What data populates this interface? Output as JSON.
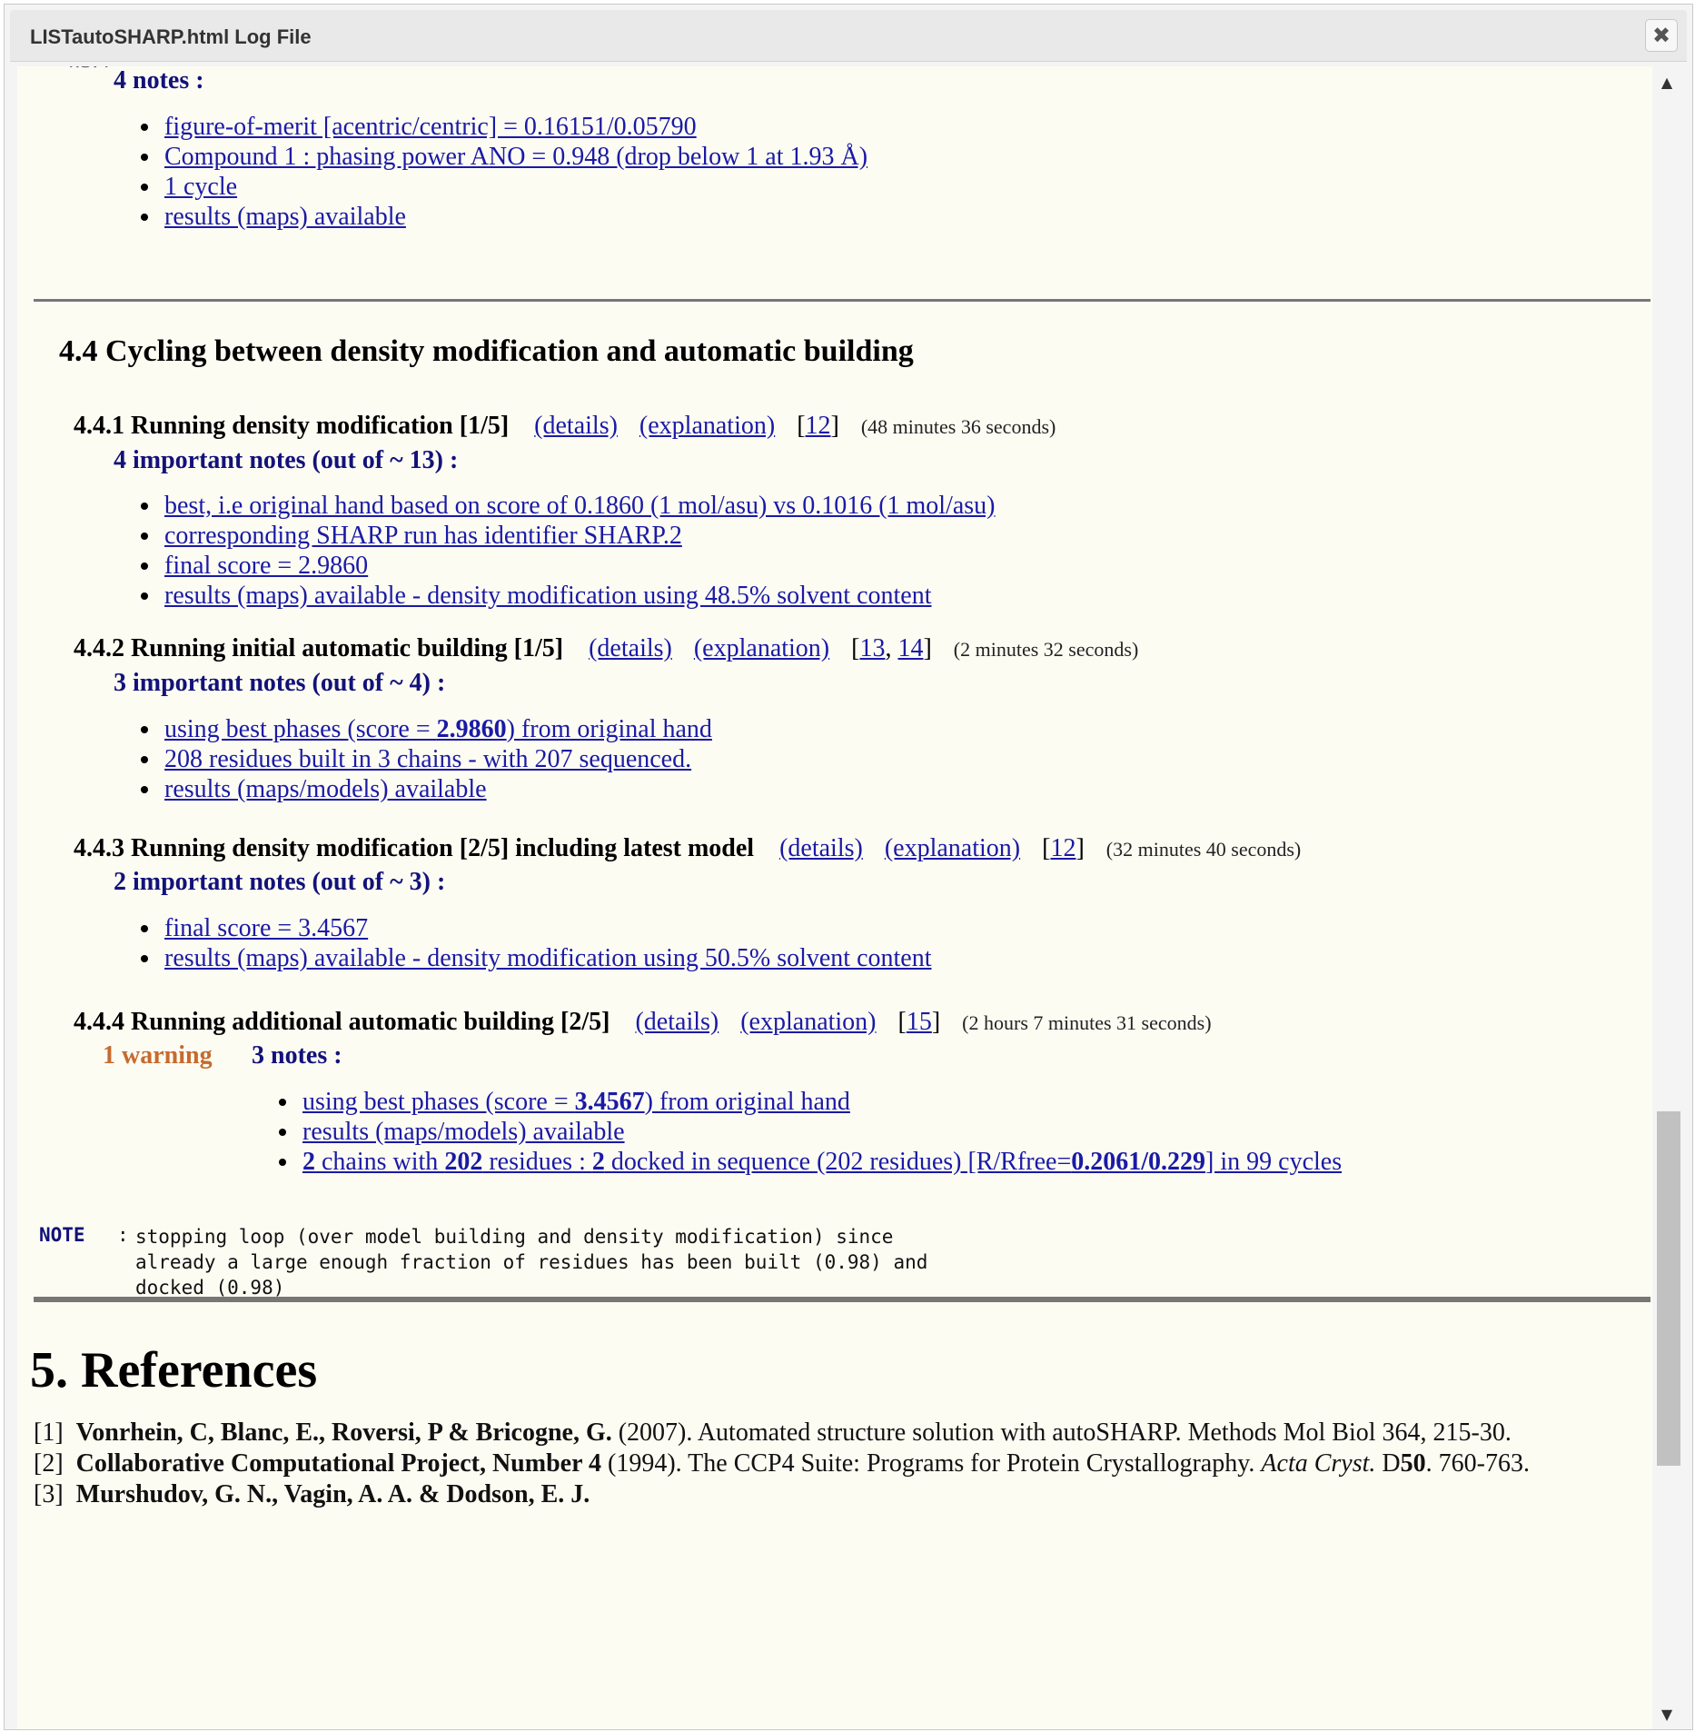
{
  "window": {
    "title": "LISTautoSHARP.html Log File",
    "close_icon": "✖"
  },
  "top_partial": {
    "notes_header": "4 notes :",
    "notes": [
      "figure-of-merit [acentric/centric] = 0.16151/0.05790",
      "Compound 1 : phasing power ANO = 0.948 (drop below 1 at 1.93 Å)",
      "1 cycle",
      "results (maps) available"
    ]
  },
  "section_4_4": {
    "title": "4.4 Cycling between density modification and automatic building"
  },
  "sub_4_4_1": {
    "title": "4.4.1 Running density modification [1/5]",
    "details": "(details)",
    "explanation": "(explanation)",
    "ref_open": "[",
    "ref1": "12",
    "ref_close": "]",
    "time": "(48 minutes 36 seconds)",
    "notes_header": "4 important notes (out of ~ 13) :",
    "notes": [
      "best, i.e original hand based on score of 0.1860 (1 mol/asu) vs 0.1016 (1 mol/asu)",
      "corresponding SHARP run has identifier SHARP.2",
      "final score = 2.9860",
      "results (maps) available - density modification using 48.5% solvent content"
    ]
  },
  "sub_4_4_2": {
    "title": "4.4.2 Running initial automatic building [1/5]",
    "details": "(details)",
    "explanation": "(explanation)",
    "ref_open": "[",
    "ref1": "13",
    "ref_sep": ", ",
    "ref2": "14",
    "ref_close": "]",
    "time": "(2 minutes 32 seconds)",
    "notes_header": "3 important notes (out of ~ 4) :",
    "note1_pre": "using best phases (score = ",
    "note1_bold": "2.9860",
    "note1_post": ") from original hand",
    "note2": "208 residues built in 3 chains - with 207 sequenced.",
    "note3": "results (maps/models) available"
  },
  "sub_4_4_3": {
    "title": "4.4.3 Running density modification [2/5] including latest model",
    "details": "(details)",
    "explanation": "(explanation)",
    "ref_open": "[",
    "ref1": "12",
    "ref_close": "]",
    "time": "(32 minutes 40 seconds)",
    "notes_header": "2 important notes (out of ~ 3) :",
    "notes": [
      "final score = 3.4567",
      "results (maps) available - density modification using 50.5% solvent content"
    ]
  },
  "sub_4_4_4": {
    "title": "4.4.4 Running additional automatic building [2/5]",
    "details": "(details)",
    "explanation": "(explanation)",
    "ref_open": "[",
    "ref1": "15",
    "ref_close": "]",
    "time": "(2 hours 7 minutes 31 seconds)",
    "warning": "1 warning",
    "notes_header": "3 notes :",
    "note1_pre": "using best phases (score = ",
    "note1_bold": "3.4567",
    "note1_post": ") from original hand",
    "note2": "results (maps/models) available",
    "note3_parts": [
      "2",
      " chains with ",
      "202",
      " residues : ",
      "2",
      " docked in sequence (202 residues) [R/Rfree=",
      "0.2061/0.229",
      "] in 99 cycles"
    ]
  },
  "note_block": {
    "label": "NOTE",
    "colon": ":",
    "lines": [
      "stopping loop (over model building and density modification) since",
      "already a large enough fraction of residues has been built (0.98) and",
      "docked (0.98)"
    ]
  },
  "references": {
    "title": "5. References",
    "items": [
      {
        "num": "[1]",
        "authors": "Vonrhein, C, Blanc, E., Roversi, P & Bricogne, G.",
        "text": " (2007). Automated structure solution with autoSHARP. Methods Mol Biol 364, 215-30."
      },
      {
        "num": "[2]",
        "authors": "Collaborative Computational Project, Number 4",
        "text": " (1994). The CCP4 Suite: Programs for Protein Crystallography. ",
        "journal": "Acta Cryst.",
        "vol_pre": " D",
        "vol_bold": "50",
        "vol_post": ". 760-763."
      },
      {
        "num": "[3]",
        "authors": "Murshudov, G. N., Vagin, A. A. & Dodson, E. J."
      }
    ]
  },
  "colors": {
    "heading_blue": "#12127a",
    "link_blue": "#1a1aa6",
    "warning_orange": "#c76a2e",
    "content_bg": "#fdfcf3"
  }
}
